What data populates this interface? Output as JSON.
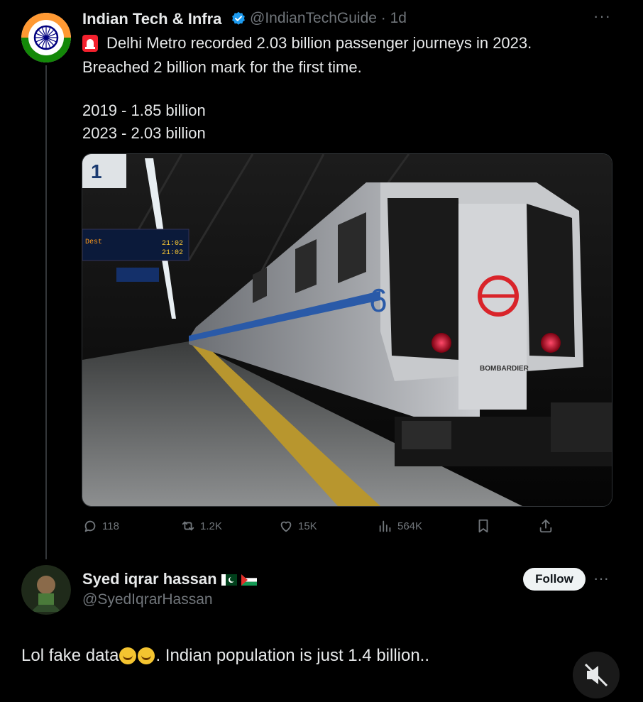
{
  "tweet": {
    "author_name": "Indian Tech & Infra",
    "author_handle": "@IndianTechGuide · 1d",
    "line1": "Delhi Metro recorded 2.03 billion passenger journeys in 2023.",
    "line2": "Breached 2 billion mark for the first time.",
    "stat1": "2019 - 1.85 billion",
    "stat2": "2023 - 2.03 billion",
    "media": {
      "platform_number": "1",
      "train_number": "6",
      "maker": "BOMBARDIER",
      "board_times": [
        "21:02",
        "21:02"
      ]
    },
    "actions": {
      "replies": "118",
      "reposts": "1.2K",
      "likes": "15K",
      "views": "564K"
    }
  },
  "reply": {
    "author_name": "Syed iqrar hassan",
    "author_handle": "@SyedIqrarHassan",
    "follow_label": "Follow",
    "text_part1": "Lol fake data",
    "text_part2": ". Indian population is just 1.4 billion.."
  },
  "colors": {
    "background": "#000000",
    "text": "#e7e9ea",
    "muted": "#71767b",
    "verified": "#1d9bf0"
  },
  "icons": [
    "more-icon",
    "verified-badge-icon",
    "alarm-light-icon",
    "reply-icon",
    "repost-icon",
    "like-icon",
    "views-icon",
    "bookmark-icon",
    "share-icon",
    "mute-icon"
  ]
}
